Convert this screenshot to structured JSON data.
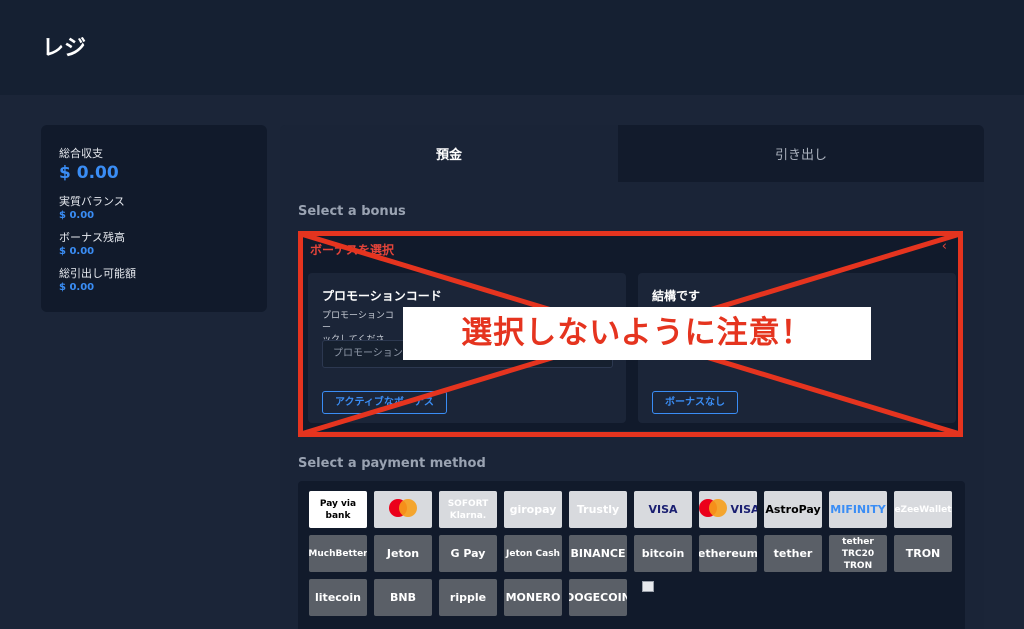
{
  "page": {
    "title": "レジ"
  },
  "balance": {
    "total_label": "総合収支",
    "total_value": "$ 0.00",
    "real_label": "実質バランス",
    "real_value": "$ 0.00",
    "bonus_label": "ボーナス残高",
    "bonus_value": "$ 0.00",
    "withdrawable_label": "総引出し可能額",
    "withdrawable_value": "$ 0.00"
  },
  "tabs": [
    {
      "label": "預金"
    },
    {
      "label": "引き出し"
    }
  ],
  "bonus": {
    "section_title": "Select a bonus",
    "header": "ボーナスを選択",
    "chevron": "‹",
    "promo": {
      "title": "プロモーションコード",
      "description": "プロモーションコー\nックしてください。",
      "input_placeholder": "プロモーション",
      "button": "アクティブなボーナス"
    },
    "none": {
      "title": "結構です",
      "button": "ボーナスなし"
    },
    "warning": "選択しないように注意！"
  },
  "payment": {
    "section_title": "Select a payment method",
    "methods": [
      {
        "label": "Pay via bank",
        "icon": "bank-icon",
        "color": "#000000"
      },
      {
        "label": "",
        "icon": "mastercard-icon",
        "color": "#f79e1b"
      },
      {
        "label": "SOFORT Klarna.",
        "icon": "sofort-klarna-icon",
        "color": "#ffffff"
      },
      {
        "label": "giropay",
        "icon": "giropay-icon",
        "color": "#ffffff"
      },
      {
        "label": "Trustly",
        "icon": "trustly-icon",
        "color": "#ffffff"
      },
      {
        "label": "VISA",
        "icon": "visa-icon",
        "color": "#1a1f71"
      },
      {
        "label": "VISA",
        "icon": "mastercard-visa-icon",
        "color": "#1a1f71"
      },
      {
        "label": "AstroPay",
        "icon": "astropay-icon",
        "color": "#000000"
      },
      {
        "label": "MIFINITY",
        "icon": "mifinity-icon",
        "color": "#3a8df5"
      },
      {
        "label": "eZeeWallet",
        "icon": "ezeewallet-icon",
        "color": "#ffffff"
      },
      {
        "label": "MuchBetter",
        "icon": "muchbetter-icon",
        "color": "#ffffff"
      },
      {
        "label": "Jeton",
        "icon": "jeton-icon",
        "color": "#ffffff"
      },
      {
        "label": "G Pay",
        "icon": "gpay-icon",
        "color": "#ffffff"
      },
      {
        "label": "Jeton Cash",
        "icon": "jeton-cash-icon",
        "color": "#ffffff"
      },
      {
        "label": "BINANCE",
        "icon": "binance-icon",
        "color": "#ffffff"
      },
      {
        "label": "bitcoin",
        "icon": "bitcoin-icon",
        "color": "#ffffff"
      },
      {
        "label": "ethereum",
        "icon": "ethereum-icon",
        "color": "#ffffff"
      },
      {
        "label": "tether",
        "icon": "tether-icon",
        "color": "#ffffff"
      },
      {
        "label": "tether TRC20 TRON",
        "icon": "tether-trc20-icon",
        "color": "#ffffff"
      },
      {
        "label": "TRON",
        "icon": "tron-icon",
        "color": "#ffffff"
      },
      {
        "label": "litecoin",
        "icon": "litecoin-icon",
        "color": "#ffffff"
      },
      {
        "label": "BNB",
        "icon": "bnb-icon",
        "color": "#ffffff"
      },
      {
        "label": "ripple",
        "icon": "ripple-icon",
        "color": "#ffffff"
      },
      {
        "label": "MONERO",
        "icon": "monero-icon",
        "color": "#ffffff"
      },
      {
        "label": "DOGECOIN",
        "icon": "dogecoin-icon",
        "color": "#ffffff"
      }
    ]
  },
  "colors": {
    "accent": "#3a8df5",
    "warning": "#e5341f"
  }
}
